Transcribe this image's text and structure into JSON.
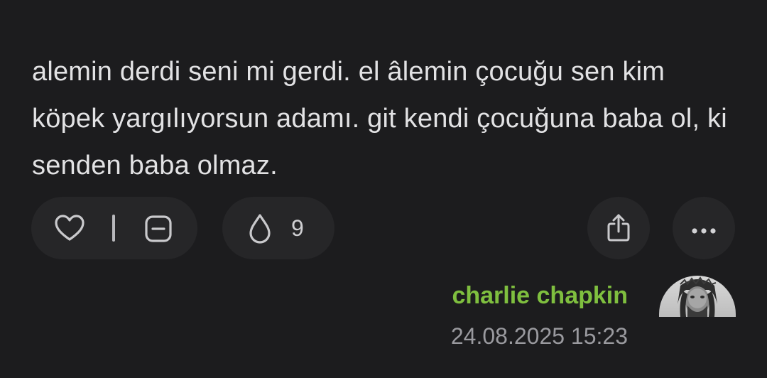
{
  "entry": {
    "text": "alemin derdi seni mi gerdi. el âlemin çocuğu sen kim köpek yargılıyorsun adamı. git kendi çocuğuna baba ol, ki senden baba olmaz."
  },
  "actions": {
    "like_icon": "heart-icon",
    "dislike_icon": "minus-square-icon",
    "drop_icon": "drop-icon",
    "drop_count": "9",
    "share_icon": "share-icon",
    "more_icon": "more-dots-icon"
  },
  "author": {
    "name": "charlie chapkin",
    "date": "24.08.2025 15:23",
    "name_color": "#7fbf3f"
  },
  "colors": {
    "background": "#1c1c1e",
    "button_bg": "#262628",
    "text": "#e2e2e4",
    "muted": "#9a9a9f"
  }
}
